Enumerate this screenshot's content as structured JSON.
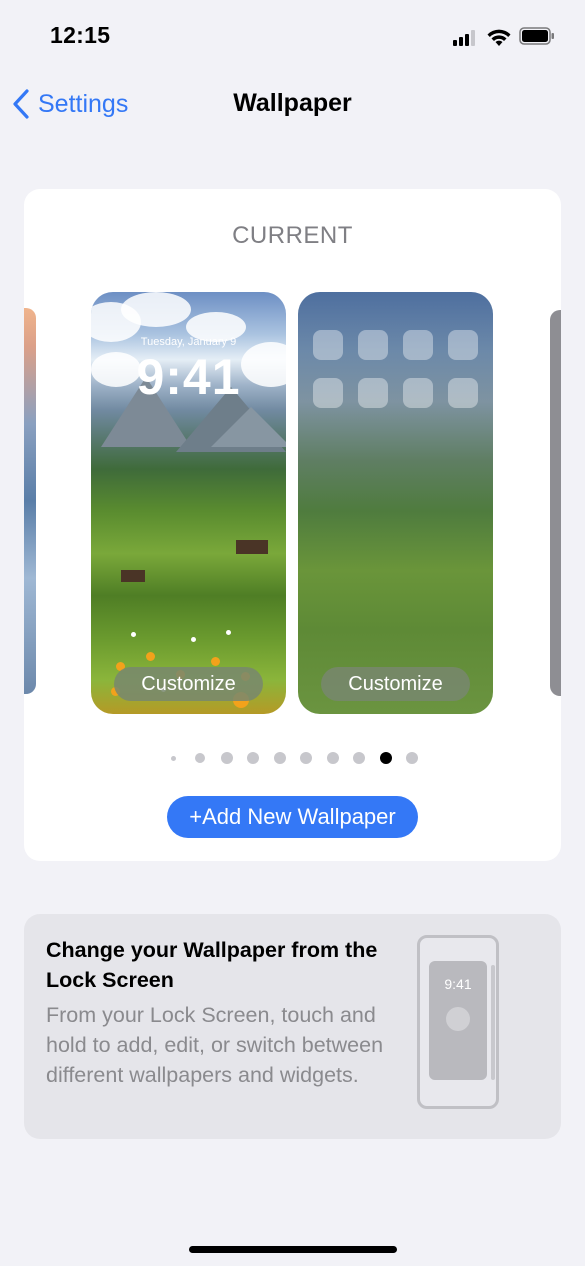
{
  "status_bar": {
    "time": "12:15",
    "icons": [
      "signal-icon",
      "wifi-icon",
      "battery-icon"
    ]
  },
  "nav": {
    "back_label": "Settings",
    "title": "Wallpaper"
  },
  "wallpaper_card": {
    "section_label": "CURRENT",
    "lock_screen": {
      "date": "Tuesday, January 9",
      "time": "9:41",
      "customize_label": "Customize"
    },
    "home_screen": {
      "customize_label": "Customize"
    },
    "page_dots": {
      "count": 10,
      "selected_index": 8
    },
    "add_button_label": "+Add New Wallpaper"
  },
  "tip": {
    "title": "Change your Wallpaper from the Lock Screen",
    "body": "From your Lock Screen, touch and hold to add, edit, or switch between different wallpapers and widgets.",
    "illustration_time": "9:41"
  },
  "colors": {
    "accent": "#3478f6",
    "background": "#f2f2f7",
    "card": "#ffffff",
    "tip_card": "#e5e5ea"
  }
}
